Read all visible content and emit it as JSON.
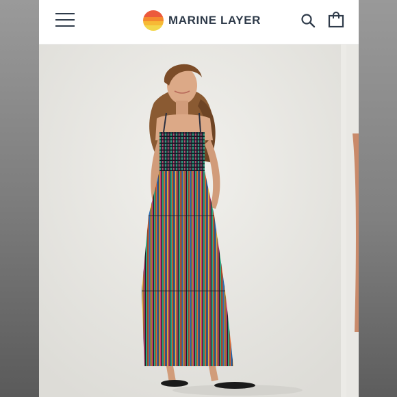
{
  "brand": {
    "name": "MARINE LAYER",
    "logo_colors": [
      "#ec5a3c",
      "#f48a2e",
      "#f7b935",
      "#f3d64a"
    ]
  },
  "header": {
    "menu_icon": "hamburger-menu-icon",
    "search_icon": "search-icon",
    "bag_icon": "shopping-bag-icon",
    "text_color": "#2f3b4a"
  },
  "product_gallery": {
    "main_image": "model-wearing-striped-smocked-maxi-dress",
    "next_image": "partial-next-product-photo"
  }
}
